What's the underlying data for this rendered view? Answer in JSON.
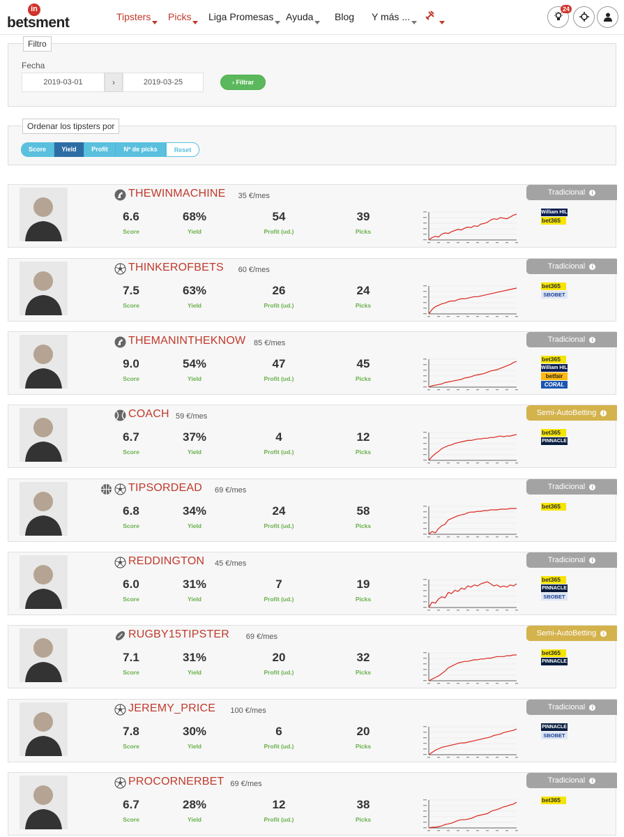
{
  "nav": {
    "logo_text": "betsment",
    "logo_mark": "in",
    "items": [
      {
        "label": "Tipsters",
        "highlight": true
      },
      {
        "label": "Picks",
        "highlight": true
      },
      {
        "label": "Liga Promesas",
        "highlight": false
      },
      {
        "label": "Ayuda",
        "highlight": false
      },
      {
        "label": "Blog",
        "highlight": false
      },
      {
        "label": "Y más ...",
        "highlight": false
      }
    ],
    "tools_icon": "hammer-wrench-icon",
    "notifications_count": "24",
    "icons": [
      "lightbulb-icon",
      "crosshair-icon",
      "user-icon"
    ]
  },
  "filter": {
    "legend": "Filtro",
    "date_label": "Fecha",
    "date_from": "2019-03-01",
    "date_to": "2019-03-25",
    "arrow": "›",
    "button_label": "› Filtrar"
  },
  "sort": {
    "legend": "Ordenar los tipsters por",
    "buttons": [
      "Score",
      "Yield",
      "Profit",
      "Nº de picks",
      "Reset"
    ],
    "active": "Yield"
  },
  "labels": {
    "score": "Score",
    "yield": "Yield",
    "profit": "Profit (ud.)",
    "picks": "Picks"
  },
  "colors": {
    "accent_red": "#c0392b",
    "stat_green": "#6ab04c",
    "tag_grey": "#a3a3a3",
    "tag_gold": "#d4b24c",
    "sort_blue": "#5bc0de",
    "filter_green": "#5cb85c"
  },
  "tipsters": [
    {
      "name": "THEWINMACHINE",
      "price": "35 €/mes",
      "sports": [
        "horse-racing-icon"
      ],
      "score": "6.6",
      "yield": "68%",
      "profit": "54",
      "picks": "39",
      "tag": "Tradicional",
      "tag_type": "grey",
      "bookmakers": [
        "William HILL",
        "bet365"
      ]
    },
    {
      "name": "THINKEROFBETS",
      "price": "60 €/mes",
      "sports": [
        "soccer-ball-icon"
      ],
      "score": "7.5",
      "yield": "63%",
      "profit": "26",
      "picks": "24",
      "tag": "Tradicional",
      "tag_type": "grey",
      "bookmakers": [
        "bet365",
        "SBOBET"
      ]
    },
    {
      "name": "THEMANINTHEKNOW",
      "price": "85 €/mes",
      "sports": [
        "horse-racing-icon"
      ],
      "score": "9.0",
      "yield": "54%",
      "profit": "47",
      "picks": "45",
      "tag": "Tradicional",
      "tag_type": "grey",
      "bookmakers": [
        "bet365",
        "William HILL",
        "betfair",
        "CORAL"
      ]
    },
    {
      "name": "COACH",
      "price": "59 €/mes",
      "sports": [
        "tennis-ball-icon"
      ],
      "score": "6.7",
      "yield": "37%",
      "profit": "4",
      "picks": "12",
      "tag": "Semi-AutoBetting",
      "tag_type": "gold",
      "bookmakers": [
        "bet365",
        "PINNACLE"
      ]
    },
    {
      "name": "TIPSORDEAD",
      "price": "69 €/mes",
      "sports": [
        "basketball-icon",
        "soccer-ball-icon"
      ],
      "score": "6.8",
      "yield": "34%",
      "profit": "24",
      "picks": "58",
      "tag": "Tradicional",
      "tag_type": "grey",
      "bookmakers": [
        "bet365"
      ]
    },
    {
      "name": "REDDINGTON",
      "price": "45 €/mes",
      "sports": [
        "soccer-ball-icon"
      ],
      "score": "6.0",
      "yield": "31%",
      "profit": "7",
      "picks": "19",
      "tag": "Tradicional",
      "tag_type": "grey",
      "bookmakers": [
        "bet365",
        "PINNACLE",
        "SBOBET"
      ]
    },
    {
      "name": "RUGBY15TIPSTER",
      "price": "69 €/mes",
      "sports": [
        "rugby-ball-icon"
      ],
      "score": "7.1",
      "yield": "31%",
      "profit": "20",
      "picks": "32",
      "tag": "Semi-AutoBetting",
      "tag_type": "gold",
      "bookmakers": [
        "bet365",
        "PINNACLE"
      ]
    },
    {
      "name": "JEREMY_PRICE",
      "price": "100 €/mes",
      "sports": [
        "soccer-ball-icon"
      ],
      "score": "7.8",
      "yield": "30%",
      "profit": "6",
      "picks": "20",
      "tag": "Tradicional",
      "tag_type": "grey",
      "bookmakers": [
        "PINNACLE",
        "SBOBET"
      ]
    },
    {
      "name": "PROCORNERBET",
      "price": "69 €/mes",
      "sports": [
        "soccer-ball-icon"
      ],
      "score": "6.7",
      "yield": "28%",
      "profit": "12",
      "picks": "38",
      "tag": "Tradicional",
      "tag_type": "grey",
      "bookmakers": [
        "bet365"
      ]
    }
  ]
}
